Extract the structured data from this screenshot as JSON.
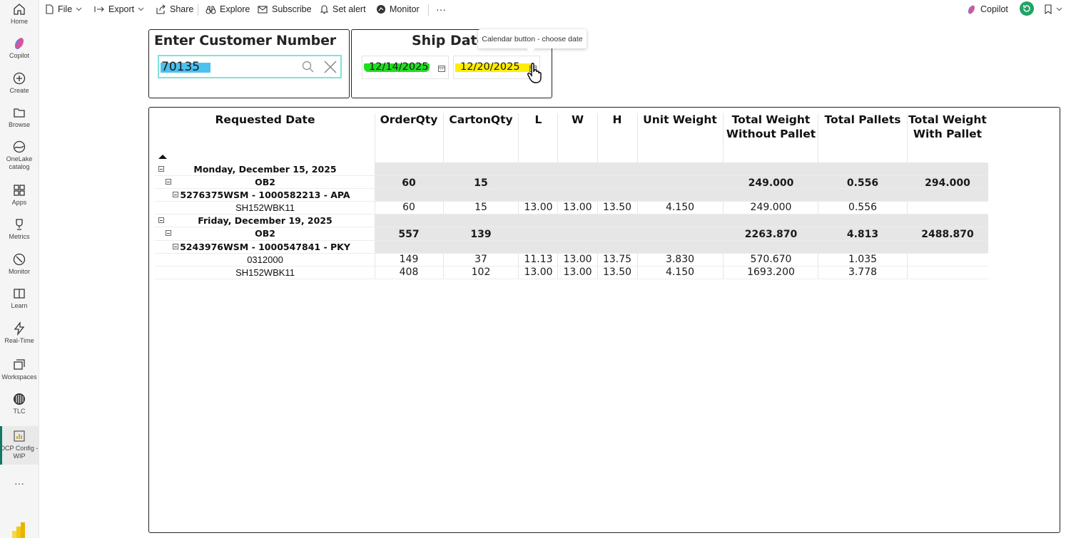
{
  "nav": {
    "items": [
      {
        "label": "Home"
      },
      {
        "label": "Copilot"
      },
      {
        "label": "Create"
      },
      {
        "label": "Browse"
      },
      {
        "label": "OneLake catalog"
      },
      {
        "label": "Apps"
      },
      {
        "label": "Metrics"
      },
      {
        "label": "Monitor"
      },
      {
        "label": "Learn"
      },
      {
        "label": "Real-Time"
      },
      {
        "label": "Workspaces"
      },
      {
        "label": "TLC"
      },
      {
        "label": "DCP Config - WIP"
      }
    ],
    "more": "···"
  },
  "toolbar": {
    "file": "File",
    "export": "Export",
    "share": "Share",
    "explore": "Explore",
    "subscribe": "Subscribe",
    "set_alert": "Set alert",
    "monitor": "Monitor",
    "more": "···",
    "copilot": "Copilot"
  },
  "customer_slicer": {
    "title": "Enter Customer Number",
    "value": "70135"
  },
  "ship_slicer": {
    "title": "Ship Date",
    "start": "12/14/2025",
    "end": "12/20/2025",
    "start_highlight": "#22dd22",
    "end_highlight": "#ffee00"
  },
  "tooltip": "Calendar button - choose date",
  "matrix": {
    "headers": {
      "requested_date": "Requested Date",
      "order_qty": "OrderQty",
      "carton_qty": "CartonQty",
      "l": "L",
      "w": "W",
      "h": "H",
      "unit_weight": "Unit Weight",
      "total_weight_without_pallet": "Total Weight Without Pallet",
      "total_pallets": "Total Pallets",
      "total_weight_with_pallet": "Total Weight With Pallet"
    },
    "rows": [
      {
        "label": "Monday, December 15, 2025",
        "order": "",
        "carton": "",
        "l": "",
        "w": "",
        "h": "",
        "unit": "",
        "twop": "",
        "pallets": "",
        "twp": ""
      },
      {
        "label": "OB2",
        "order": "60",
        "carton": "15",
        "l": "",
        "w": "",
        "h": "",
        "unit": "",
        "twop": "249.000",
        "pallets": "0.556",
        "twp": "294.000"
      },
      {
        "label": "5276375WSM - 1000582213 - APA",
        "order": "",
        "carton": "",
        "l": "",
        "w": "",
        "h": "",
        "unit": "",
        "twop": "",
        "pallets": "",
        "twp": ""
      },
      {
        "label": "SH152WBK11",
        "order": "60",
        "carton": "15",
        "l": "13.00",
        "w": "13.00",
        "h": "13.50",
        "unit": "4.150",
        "twop": "249.000",
        "pallets": "0.556",
        "twp": ""
      },
      {
        "label": "Friday, December 19, 2025",
        "order": "",
        "carton": "",
        "l": "",
        "w": "",
        "h": "",
        "unit": "",
        "twop": "",
        "pallets": "",
        "twp": ""
      },
      {
        "label": "OB2",
        "order": "557",
        "carton": "139",
        "l": "",
        "w": "",
        "h": "",
        "unit": "",
        "twop": "2263.870",
        "pallets": "4.813",
        "twp": "2488.870"
      },
      {
        "label": "5243976WSM - 1000547841 - PKY",
        "order": "",
        "carton": "",
        "l": "",
        "w": "",
        "h": "",
        "unit": "",
        "twop": "",
        "pallets": "",
        "twp": ""
      },
      {
        "label": "0312000",
        "order": "149",
        "carton": "37",
        "l": "11.13",
        "w": "13.00",
        "h": "13.75",
        "unit": "3.830",
        "twop": "570.670",
        "pallets": "1.035",
        "twp": ""
      },
      {
        "label": "SH152WBK11",
        "order": "408",
        "carton": "102",
        "l": "13.00",
        "w": "13.00",
        "h": "13.50",
        "unit": "4.150",
        "twop": "1693.200",
        "pallets": "3.778",
        "twp": ""
      }
    ]
  }
}
